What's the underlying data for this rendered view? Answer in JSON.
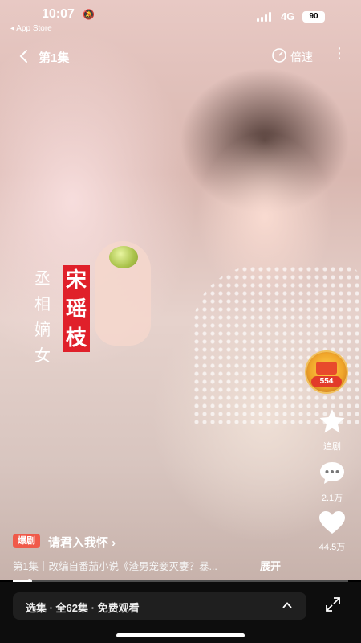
{
  "status_bar": {
    "time": "10:07",
    "back_to_app": "◂ App Store",
    "network": "4G",
    "battery": "90"
  },
  "top_bar": {
    "episode_title": "第1集",
    "speed_label": "倍速"
  },
  "title_art": {
    "small_chars": [
      "丞",
      "相",
      "嫡",
      "女"
    ],
    "red_chars": [
      "宋",
      "瑶",
      "枝"
    ]
  },
  "sidebar": {
    "coin_count": "554",
    "follow_label": "追剧",
    "comment_count": "2.1万",
    "like_count": "44.5万"
  },
  "info": {
    "tag": "爆剧",
    "series_name": "请君入我怀 ›",
    "description": "第1集｜改编自番茄小说《渣男宠妾灭妻？暴...",
    "expand_label": "展开"
  },
  "progress": {
    "fraction": 0.05
  },
  "bottom_bar": {
    "episodes_label": "选集 · 全62集 · 免费观看"
  },
  "colors": {
    "accent_red": "#e0202a",
    "tag_bg": "#f05a4a"
  }
}
